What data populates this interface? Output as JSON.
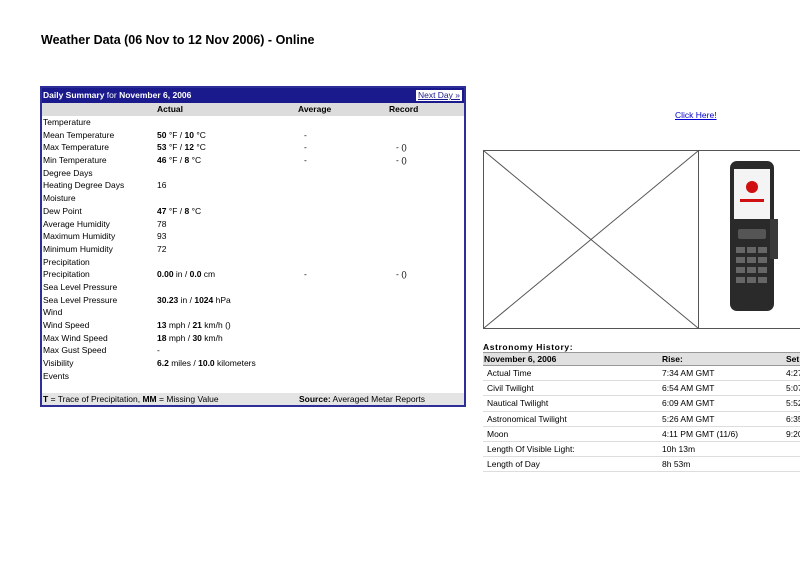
{
  "page_title": "Weather Data (06 Nov to 12 Nov 2006) - Online",
  "summary": {
    "header_bold": "Daily Summary",
    "header_for": " for ",
    "header_date": "November 6, 2006",
    "next_day": "Next Day »",
    "columns": {
      "actual": "Actual",
      "average": "Average",
      "record": "Record"
    },
    "rows": [
      {
        "label": "Temperature",
        "section": true
      },
      {
        "label": "Mean Temperature",
        "actual_bold": "50",
        "actual_text": " °F / ",
        "actual_bold2": "10",
        "actual_text2": " °C",
        "average": "-",
        "record": ""
      },
      {
        "label": "Max Temperature",
        "actual_bold": "53",
        "actual_text": " °F / ",
        "actual_bold2": "12",
        "actual_text2": " °C",
        "average": "-",
        "record": "- ()"
      },
      {
        "label": "Min Temperature",
        "actual_bold": "46",
        "actual_text": " °F / ",
        "actual_bold2": "8",
        "actual_text2": " °C",
        "average": "-",
        "record": "- ()"
      },
      {
        "label": "Degree Days",
        "section": true
      },
      {
        "label": "Heating Degree Days",
        "actual_text": "16"
      },
      {
        "label": "Moisture",
        "section": true
      },
      {
        "label": "Dew Point",
        "actual_bold": "47",
        "actual_text": " °F / ",
        "actual_bold2": "8",
        "actual_text2": " °C"
      },
      {
        "label": "Average Humidity",
        "actual_text": "78"
      },
      {
        "label": "Maximum Humidity",
        "actual_text": "93"
      },
      {
        "label": "Minimum Humidity",
        "actual_text": "72"
      },
      {
        "label": "Precipitation",
        "section": true
      },
      {
        "label": "Precipitation",
        "actual_bold": "0.00",
        "actual_text": " in / ",
        "actual_bold2": "0.0",
        "actual_text2": " cm",
        "average": "-",
        "record": "- ()"
      },
      {
        "label": "Sea Level Pressure",
        "section": true
      },
      {
        "label": "Sea Level Pressure",
        "actual_bold": "30.23",
        "actual_text": " in / ",
        "actual_bold2": "1024",
        "actual_text2": " hPa"
      },
      {
        "label": "Wind",
        "section": true
      },
      {
        "label": "Wind Speed",
        "actual_bold": "13",
        "actual_text": " mph / ",
        "actual_bold2": "21",
        "actual_text2": " km/h ()"
      },
      {
        "label": "Max Wind Speed",
        "actual_bold": "18",
        "actual_text": " mph / ",
        "actual_bold2": "30",
        "actual_text2": " km/h"
      },
      {
        "label": "Max Gust Speed",
        "actual_text": "-"
      },
      {
        "label": "Visibility",
        "actual_bold": "6.2",
        "actual_text": " miles / ",
        "actual_bold2": "10.0",
        "actual_text2": " kilometers"
      },
      {
        "label": "Events",
        "section": true
      }
    ],
    "footer_left_b1": "T",
    "footer_left_t1": " = Trace of Precipitation, ",
    "footer_left_b2": "MM",
    "footer_left_t2": " = Missing Value",
    "footer_right_b": "Source:",
    "footer_right_t": " Averaged Metar Reports"
  },
  "click_here": "Click Here!",
  "astronomy": {
    "title": "Astronomy History:",
    "header": {
      "date": "November 6, 2006",
      "rise": "Rise:",
      "set": "Set:"
    },
    "rows": [
      {
        "name": "Actual Time",
        "rise": "7:34 AM GMT",
        "set": "4:27"
      },
      {
        "name": "Civil Twilight",
        "rise": "6:54 AM GMT",
        "set": "5:07"
      },
      {
        "name": "Nautical Twilight",
        "rise": "6:09 AM GMT",
        "set": "5:52"
      },
      {
        "name": "Astronomical Twilight",
        "rise": "5:26 AM GMT",
        "set": "6:35"
      },
      {
        "name": "Moon",
        "rise": "4:11 PM GMT (11/6)",
        "set": "9:20"
      },
      {
        "name": "Length Of Visible Light:",
        "rise": "10h 13m",
        "set": ""
      },
      {
        "name": "Length of Day",
        "rise": "8h 53m",
        "set": ""
      }
    ]
  }
}
